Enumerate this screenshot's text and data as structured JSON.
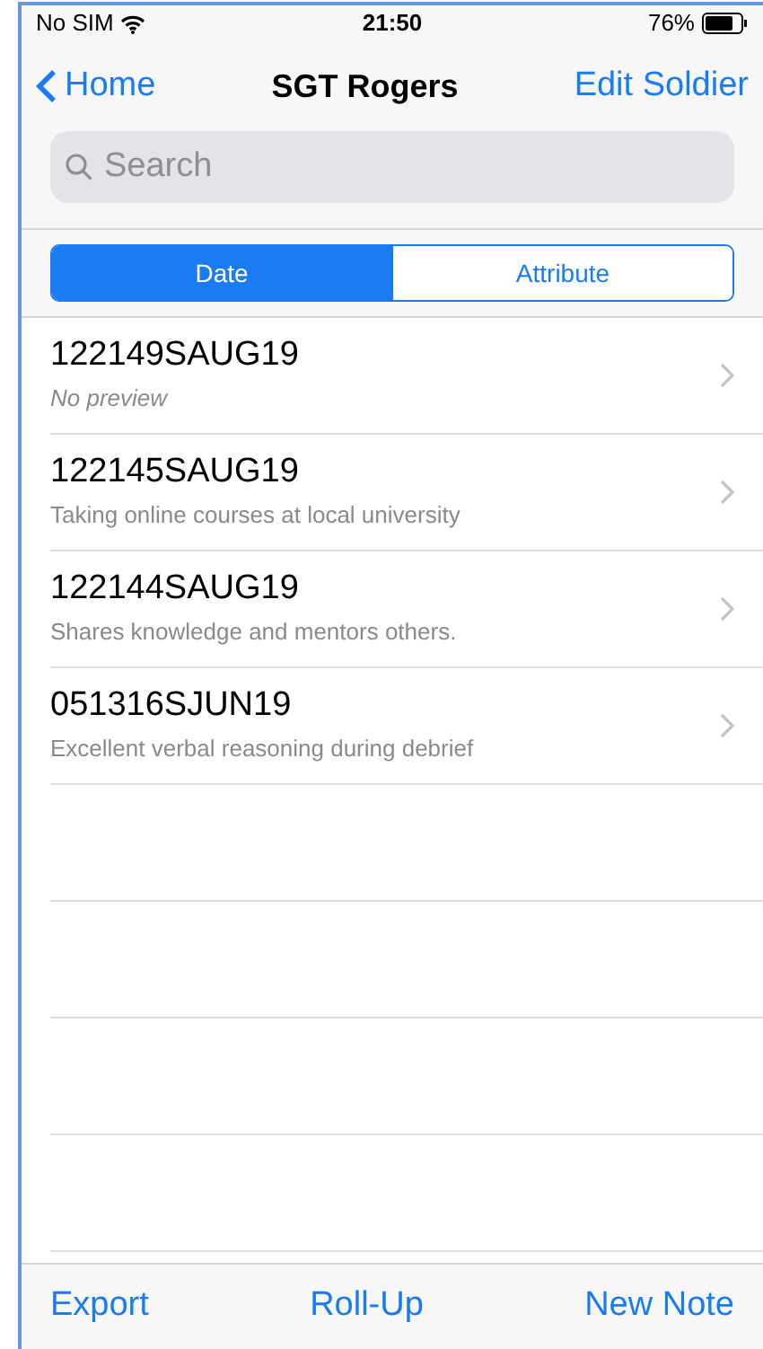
{
  "status_bar": {
    "carrier": "No SIM",
    "time": "21:50",
    "battery": "76%"
  },
  "nav": {
    "back": "Home",
    "title": "SGT Rogers",
    "action": "Edit Soldier"
  },
  "search": {
    "placeholder": "Search"
  },
  "segments": [
    {
      "label": "Date",
      "selected": true
    },
    {
      "label": "Attribute",
      "selected": false
    }
  ],
  "notes": [
    {
      "title": "122149SAUG19",
      "preview": "No preview",
      "kind": "empty"
    },
    {
      "title": "122145SAUG19",
      "preview": "Taking online courses at local university",
      "kind": "note"
    },
    {
      "title": "122144SAUG19",
      "preview": "Shares knowledge and mentors others.",
      "kind": "note"
    },
    {
      "title": "051316SJUN19",
      "preview": "Excellent verbal reasoning during debrief",
      "kind": "note"
    }
  ],
  "toolbar": [
    "Export",
    "Roll-Up",
    "New Note"
  ]
}
